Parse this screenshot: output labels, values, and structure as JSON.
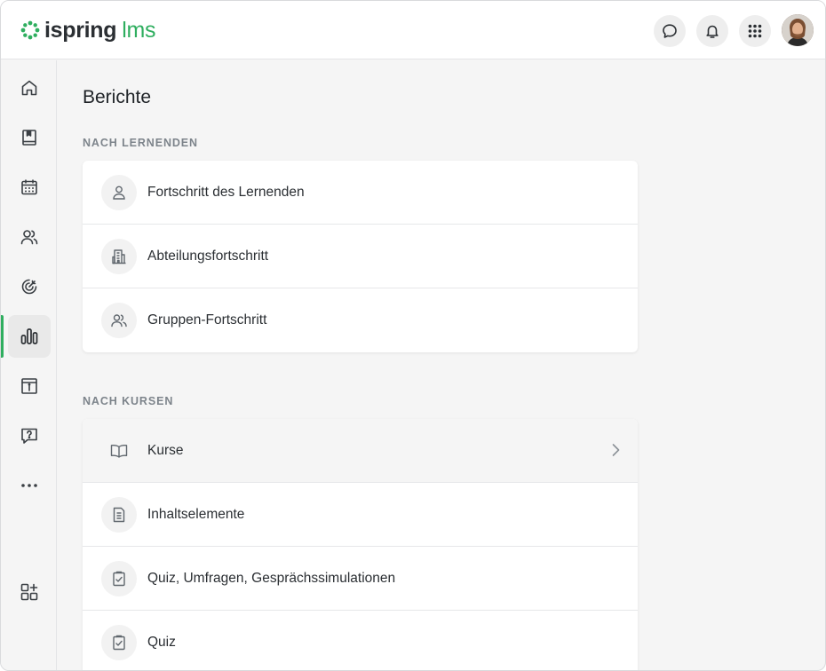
{
  "app": {
    "logo_primary": "ispring",
    "logo_secondary": "lms",
    "brand_color": "#2fae5f"
  },
  "header": {
    "buttons": [
      {
        "name": "chat-icon"
      },
      {
        "name": "bell-icon"
      },
      {
        "name": "apps-grid-icon"
      }
    ],
    "avatar": "user-avatar"
  },
  "sidebar": {
    "items": [
      {
        "icon": "home-icon",
        "active": false
      },
      {
        "icon": "book-icon",
        "active": false
      },
      {
        "icon": "calendar-icon",
        "active": false
      },
      {
        "icon": "users-icon",
        "active": false
      },
      {
        "icon": "target-icon",
        "active": false
      },
      {
        "icon": "bar-chart-icon",
        "active": true
      },
      {
        "icon": "info-catalog-icon",
        "active": false
      },
      {
        "icon": "help-chat-icon",
        "active": false
      },
      {
        "icon": "more-dots-icon",
        "active": false
      }
    ],
    "bottom_item": {
      "icon": "add-widget-icon"
    }
  },
  "main": {
    "title": "Berichte",
    "sections": [
      {
        "label": "NACH LERNENDEN",
        "items": [
          {
            "label": "Fortschritt des Lernenden",
            "icon": "person-icon"
          },
          {
            "label": "Abteilungsfortschritt",
            "icon": "building-icon"
          },
          {
            "label": "Gruppen-Fortschritt",
            "icon": "group-icon"
          }
        ]
      },
      {
        "label": "NACH KURSEN",
        "items": [
          {
            "label": "Kurse",
            "icon": "open-book-icon",
            "hovered": true
          },
          {
            "label": "Inhaltselemente",
            "icon": "document-icon"
          },
          {
            "label": "Quiz, Umfragen, Gesprächssimulationen",
            "icon": "checklist-icon"
          },
          {
            "label": "Quiz",
            "icon": "checklist-icon"
          }
        ]
      }
    ]
  }
}
